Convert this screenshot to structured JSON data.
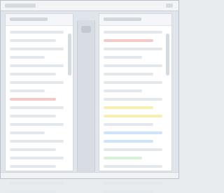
{
  "window": {
    "title": ""
  },
  "left_pane": {
    "header": "",
    "lines": [
      "",
      "",
      "",
      "",
      "",
      "",
      "",
      "",
      "",
      "",
      "",
      "",
      "",
      "",
      "",
      "",
      "",
      "",
      "",
      ""
    ]
  },
  "right_pane": {
    "header": "",
    "lines": [
      "",
      "",
      "",
      "",
      "",
      "",
      "",
      "",
      "",
      "",
      "",
      "",
      "",
      "",
      "",
      "",
      "",
      "",
      "",
      ""
    ]
  },
  "colors": {
    "background": "#e9ecef",
    "pane": "#ffffff",
    "accent_red": "#f3c9c9",
    "accent_yellow": "#f6efb4",
    "accent_blue": "#cfe3fb",
    "accent_green": "#d6f1d6"
  }
}
